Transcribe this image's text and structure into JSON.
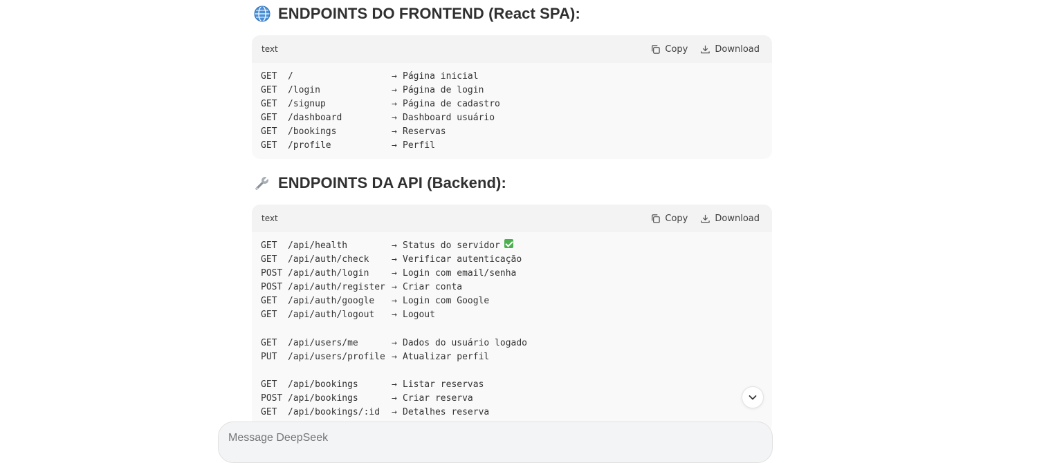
{
  "sections": [
    {
      "icon": "globe-icon",
      "title": "ENDPOINTS DO FRONTEND (React SPA):",
      "lang": "text",
      "copy_label": "Copy",
      "download_label": "Download",
      "lines": [
        {
          "method": "GET",
          "path": "/",
          "desc": "Página inicial"
        },
        {
          "method": "GET",
          "path": "/login",
          "desc": "Página de login"
        },
        {
          "method": "GET",
          "path": "/signup",
          "desc": "Página de cadastro"
        },
        {
          "method": "GET",
          "path": "/dashboard",
          "desc": "Dashboard usuário"
        },
        {
          "method": "GET",
          "path": "/bookings",
          "desc": "Reservas"
        },
        {
          "method": "GET",
          "path": "/profile",
          "desc": "Perfil"
        }
      ]
    },
    {
      "icon": "wrench-icon",
      "title": "ENDPOINTS DA API (Backend):",
      "lang": "text",
      "copy_label": "Copy",
      "download_label": "Download",
      "lines": [
        {
          "method": "GET",
          "path": "/api/health",
          "desc": "Status do servidor",
          "check": true
        },
        {
          "method": "GET",
          "path": "/api/auth/check",
          "desc": "Verificar autenticação"
        },
        {
          "method": "POST",
          "path": "/api/auth/login",
          "desc": "Login com email/senha"
        },
        {
          "method": "POST",
          "path": "/api/auth/register",
          "desc": "Criar conta"
        },
        {
          "method": "GET",
          "path": "/api/auth/google",
          "desc": "Login com Google"
        },
        {
          "method": "GET",
          "path": "/api/auth/logout",
          "desc": "Logout"
        },
        {
          "blank": true
        },
        {
          "method": "GET",
          "path": "/api/users/me",
          "desc": "Dados do usuário logado"
        },
        {
          "method": "PUT",
          "path": "/api/users/profile",
          "desc": "Atualizar perfil"
        },
        {
          "blank": true
        },
        {
          "method": "GET",
          "path": "/api/bookings",
          "desc": "Listar reservas"
        },
        {
          "method": "POST",
          "path": "/api/bookings",
          "desc": "Criar reserva"
        },
        {
          "method": "GET",
          "path": "/api/bookings/:id",
          "desc": "Detalhes reserva"
        }
      ]
    }
  ],
  "arrow": "→",
  "composer": {
    "placeholder": "Message DeepSeek"
  }
}
